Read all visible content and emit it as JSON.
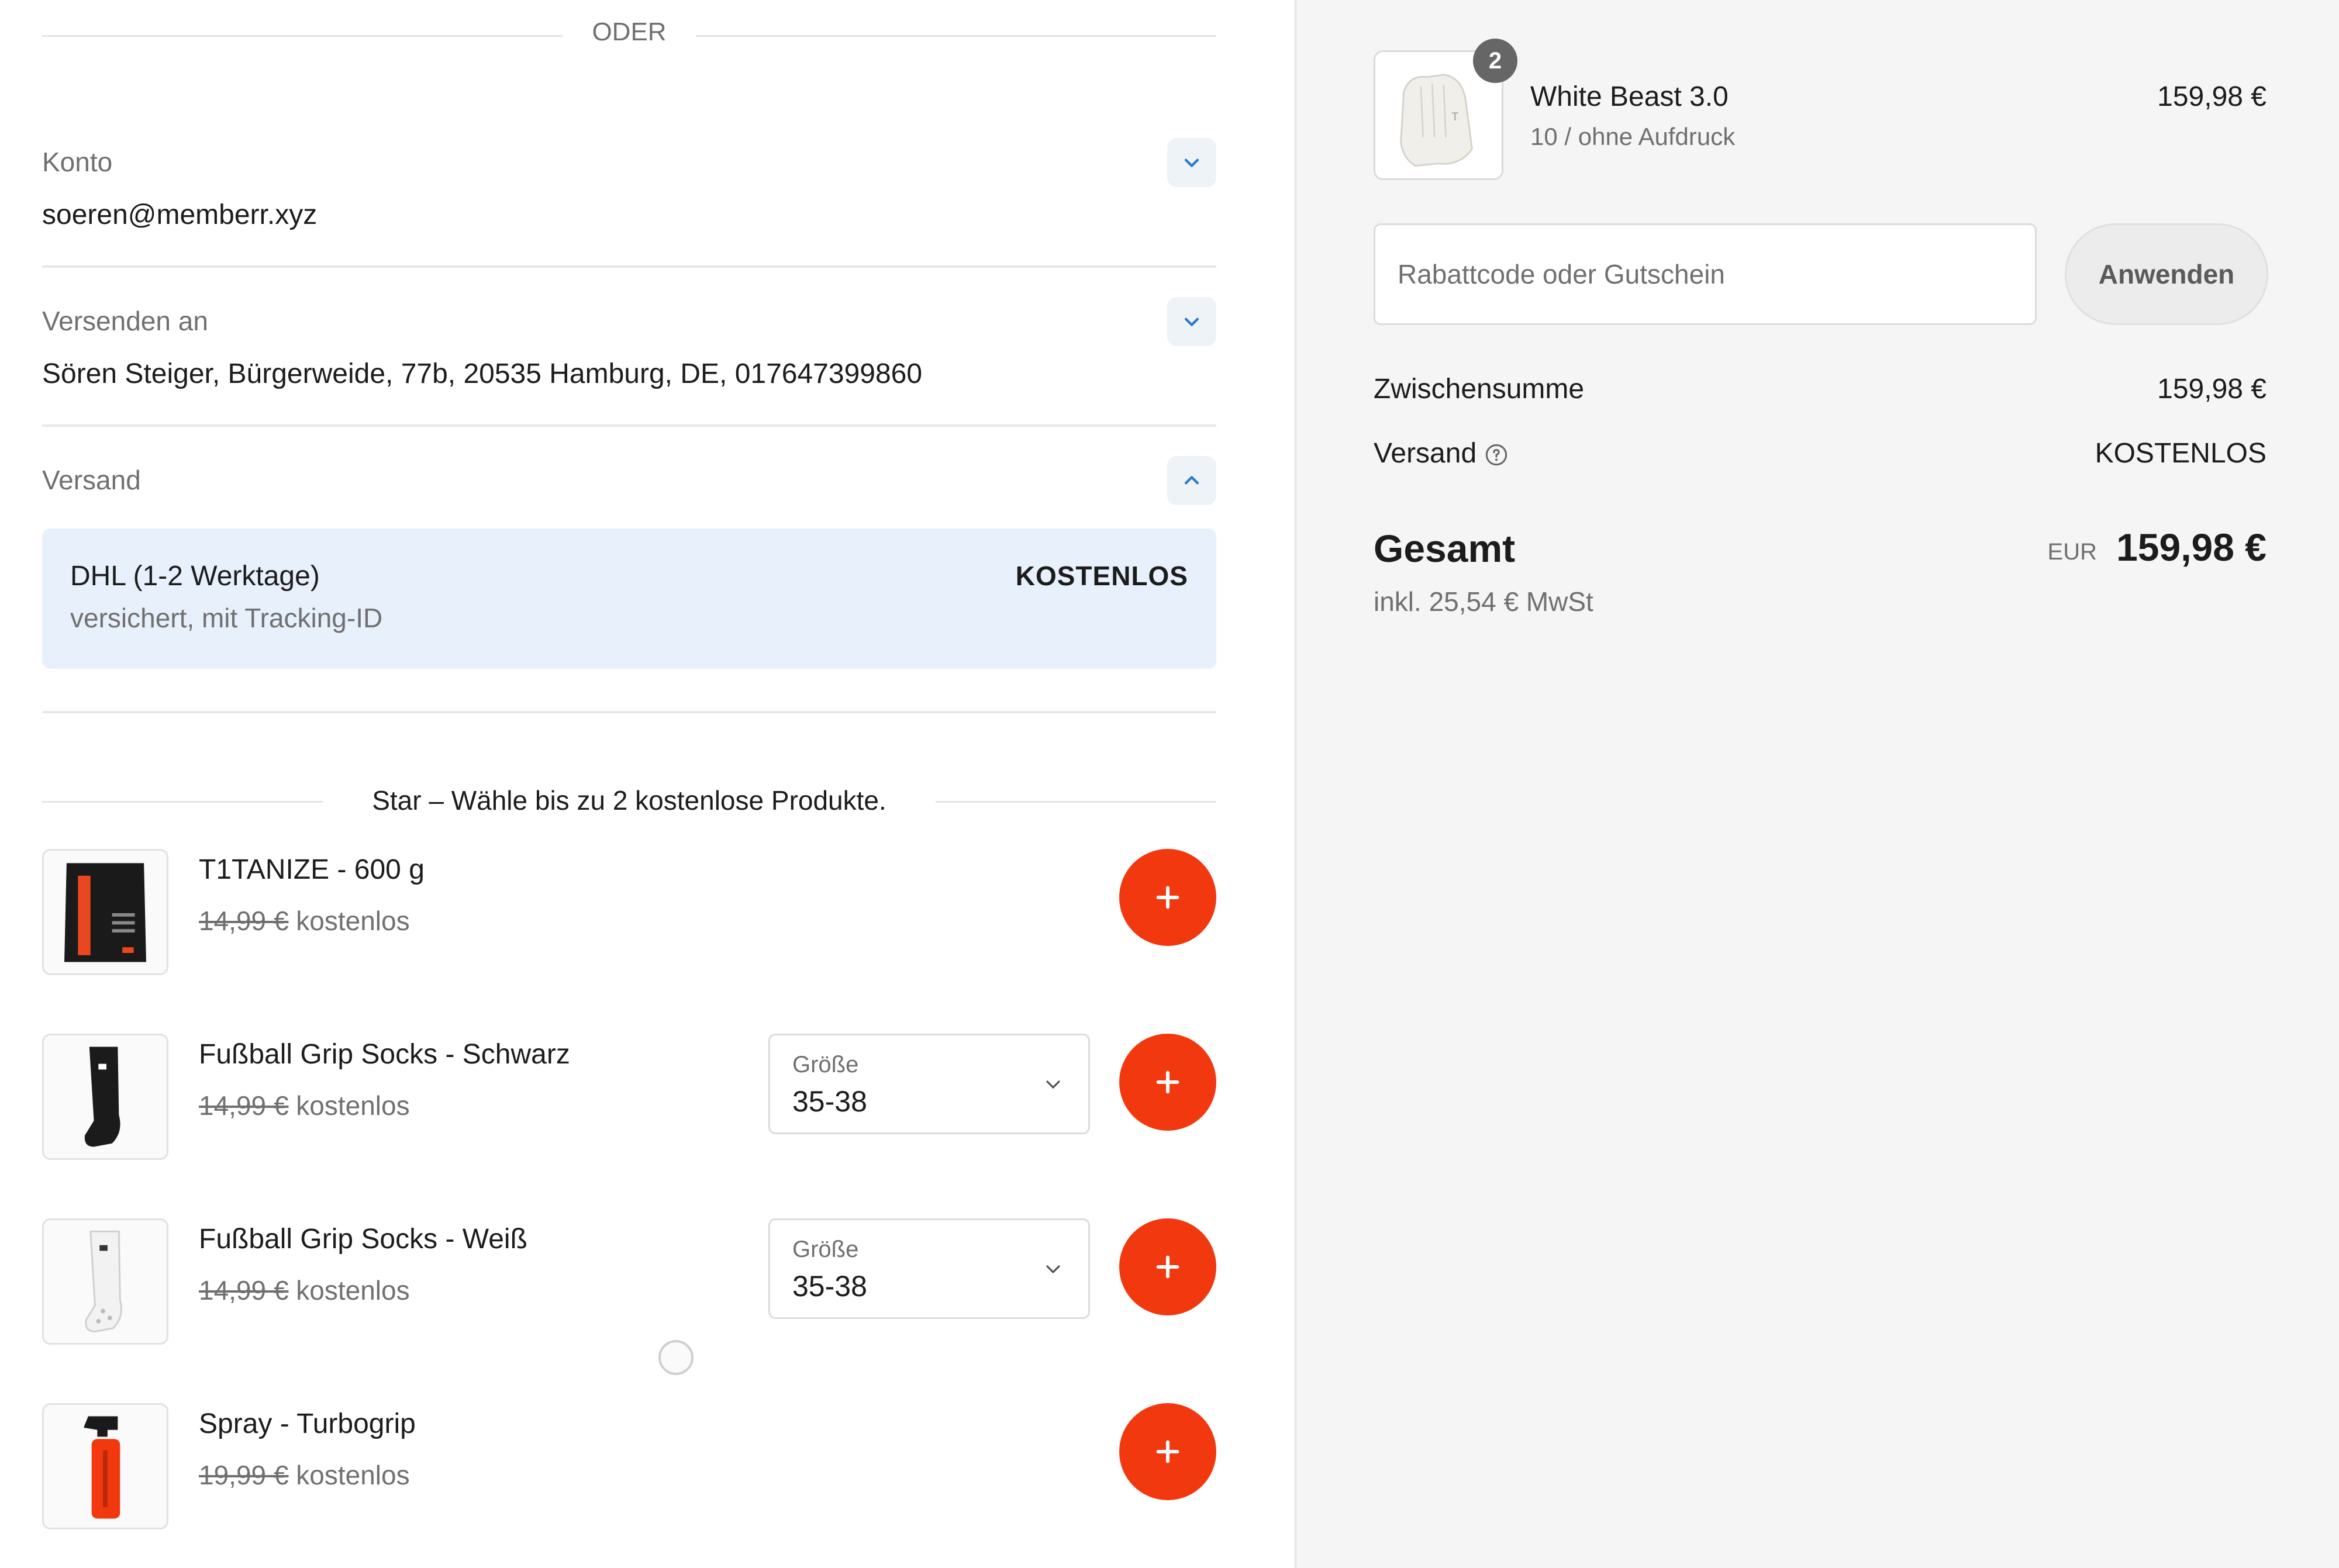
{
  "divider_text": "ODER",
  "account": {
    "label": "Konto",
    "value": "soeren@memberr.xyz"
  },
  "ship_to": {
    "label": "Versenden an",
    "value": "Sören Steiger, Bürgerweide, 77b, 20535 Hamburg, DE, 017647399860"
  },
  "shipping": {
    "label": "Versand",
    "option_title": "DHL (1-2 Werktage)",
    "option_subtitle": "versichert, mit Tracking-ID",
    "option_price": "KOSTENLOS"
  },
  "promo_heading": "Star – Wähle bis zu 2 kostenlose Produkte.",
  "free_label": "kostenlos",
  "size_label": "Größe",
  "products": [
    {
      "name": "T1TANIZE - 600 g",
      "old_price": "14,99 €"
    },
    {
      "name": "Fußball Grip Socks - Schwarz",
      "old_price": "14,99 €",
      "size": "35-38"
    },
    {
      "name": "Fußball Grip Socks - Weiß",
      "old_price": "14,99 €",
      "size": "35-38"
    },
    {
      "name": "Spray - Turbogrip",
      "old_price": "19,99 €"
    }
  ],
  "cart": {
    "quantity": "2",
    "item_name": "White Beast 3.0",
    "item_variant": "10 / ohne Aufdruck",
    "item_price": "159,98 €"
  },
  "discount": {
    "placeholder": "Rabattcode oder Gutschein",
    "button": "Anwenden"
  },
  "summary": {
    "subtotal_label": "Zwischensumme",
    "subtotal_value": "159,98 €",
    "shipping_label": "Versand",
    "shipping_value": "KOSTENLOS",
    "total_label": "Gesamt",
    "currency": "EUR",
    "total_value": "159,98 €",
    "tax_note": "inkl. 25,54 € MwSt"
  },
  "colors": {
    "accent": "#f2380f",
    "shipping_bg": "#e8f0fb",
    "sidebar_bg": "#f5f5f5"
  }
}
